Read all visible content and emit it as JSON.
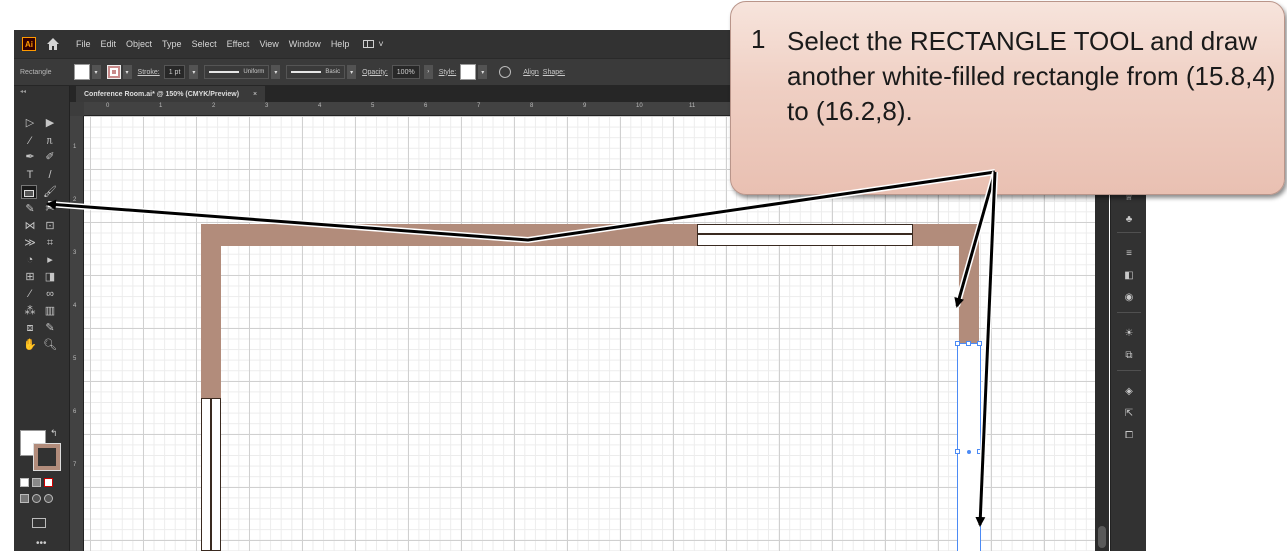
{
  "menubar": {
    "logo": "Ai",
    "items": [
      "File",
      "Edit",
      "Object",
      "Type",
      "Select",
      "Effect",
      "View",
      "Window",
      "Help"
    ],
    "workspace_caret": "˅"
  },
  "controlbar": {
    "selection_label": "Rectangle",
    "stroke_label": "Stroke:",
    "stroke_weight": "1 pt",
    "profile": "Uniform",
    "brush": "Basic",
    "opacity_label": "Opacity:",
    "opacity_value": "100%",
    "style_label": "Style:",
    "align_label": "Align",
    "shape_label": "Shape:"
  },
  "document_tab": {
    "title": "Conference Room.ai* @ 150% (CMYK/Preview)",
    "close": "×"
  },
  "ruler_top_numbers": [
    "0",
    "1",
    "2",
    "3",
    "4",
    "5",
    "6",
    "7",
    "8",
    "9",
    "10",
    "11"
  ],
  "ruler_left_numbers": [
    "1",
    "2",
    "3",
    "4",
    "5",
    "6",
    "7"
  ],
  "colors": {
    "wall": "#b28c7b",
    "selection": "#4c8bf5",
    "callout": "#efcfc3"
  },
  "callout": {
    "number": "1",
    "text": "Select the RECTANGLE TOOL and draw another white-filled rectangle from (15.8,4) to (16.2,8)."
  },
  "icons": [
    "home-icon",
    "rectangle-tool-icon",
    "selection-tool-icon",
    "pen-tool-icon",
    "type-tool-icon",
    "hand-tool-icon",
    "zoom-tool-icon"
  ]
}
